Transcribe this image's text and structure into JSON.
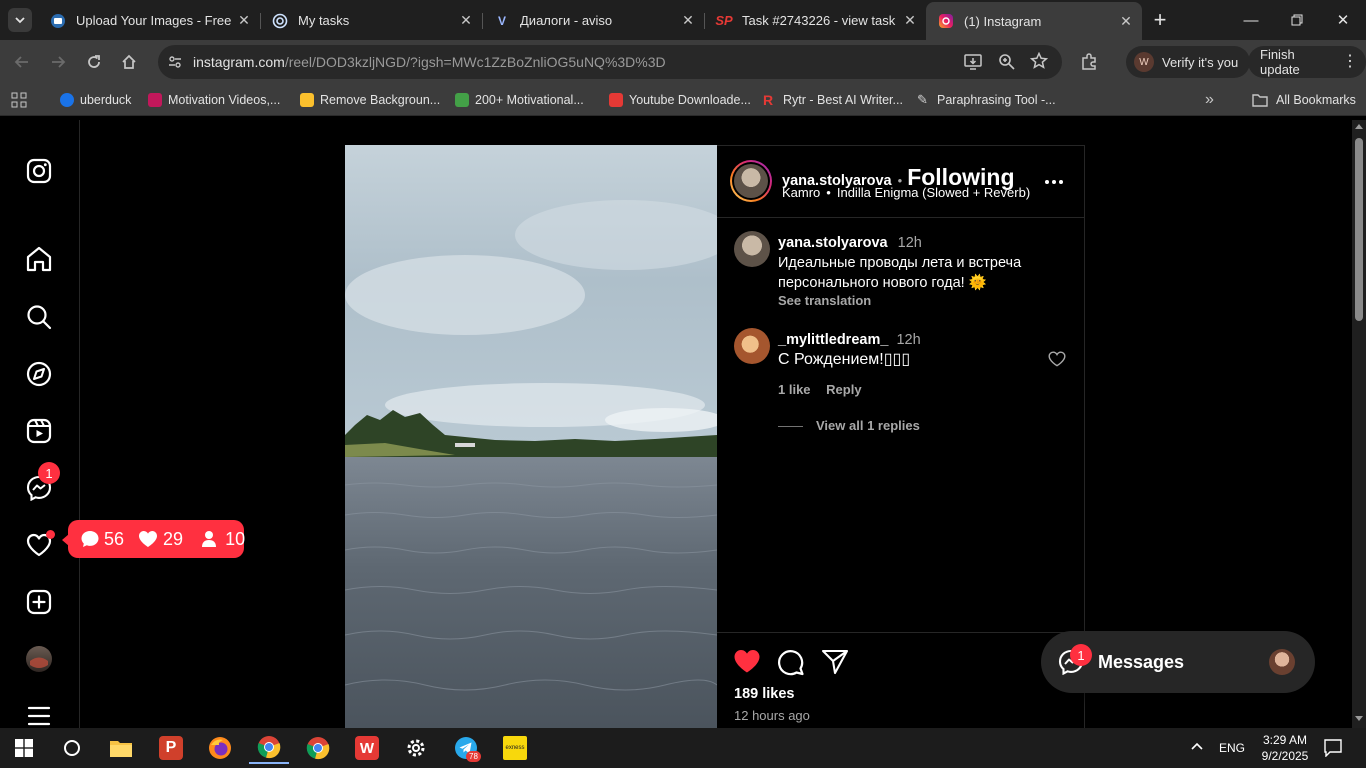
{
  "browser": {
    "tabs": [
      {
        "title": "Upload Your Images - Free I",
        "favicon": "imgbb-icon",
        "active": false
      },
      {
        "title": "My tasks",
        "favicon": "target-icon",
        "active": false
      },
      {
        "title": "Диалоги - aviso",
        "favicon": "aviso-icon",
        "active": false
      },
      {
        "title": "Task #2743226 - view task",
        "favicon": "sp-icon",
        "active": false
      },
      {
        "title": "(1) Instagram",
        "favicon": "instagram-icon",
        "active": true
      }
    ],
    "url_host": "instagram.com",
    "url_path": "/reel/DOD3kzljNGD/?igsh=MWc1ZzBoZnliOG5uNQ%3D%3D",
    "profile_button": "Verify it's you",
    "profile_avatar_letter": "W",
    "update_button": "Finish update",
    "bookmarks": [
      {
        "label": "uberduck",
        "color": "#1a73e8"
      },
      {
        "label": "Motivation Videos,...",
        "color": "#c2185b"
      },
      {
        "label": "Remove Backgroun...",
        "color": "#fbc02d"
      },
      {
        "label": "200+ Motivational...",
        "color": "#43a047"
      },
      {
        "label": "Youtube Downloade...",
        "color": "#e53935"
      },
      {
        "label": "Rytr - Best AI Writer...",
        "color": "#e53935"
      },
      {
        "label": "Paraphrasing Tool -...",
        "color": "#9e9e9e"
      }
    ],
    "all_bookmarks": "All Bookmarks"
  },
  "instagram": {
    "nav_badge_count": "1",
    "notifications": {
      "comments": "56",
      "likes": "29",
      "follows": "10"
    },
    "post": {
      "username": "yana.stolyarova",
      "follow_status": "Following",
      "separator": "•",
      "audio_artist": "Kamro",
      "audio_track": "Indilla Enigma (Slowed + Reverb)",
      "caption_user": "yana.stolyarova",
      "caption_time": "12h",
      "caption_text": "Идеальные проводы лета и встреча персонального нового года! 🌞",
      "see_translation": "See translation",
      "comments": [
        {
          "username": "_mylittledream_",
          "time": "12h",
          "text": "С Рождением!▯▯▯",
          "likes": "1 like",
          "reply": "Reply",
          "view_replies": "View all 1 replies"
        }
      ],
      "likes_count": "189 likes",
      "posted_ago": "12 hours ago"
    },
    "messages": {
      "label": "Messages",
      "badge": "1"
    }
  },
  "taskbar": {
    "language": "ENG",
    "time": "3:29 AM",
    "date": "9/2/2025",
    "telegram_badge": "78"
  }
}
